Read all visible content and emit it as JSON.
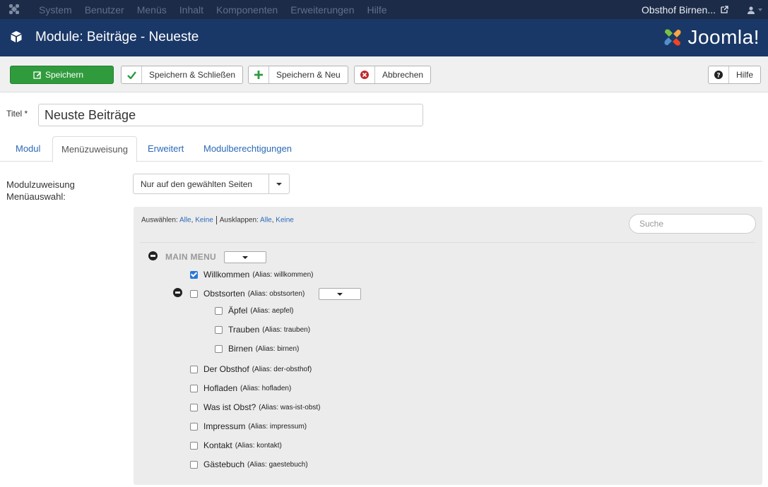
{
  "navbar": {
    "menu": [
      "System",
      "Benutzer",
      "Menüs",
      "Inhalt",
      "Komponenten",
      "Erweiterungen",
      "Hilfe"
    ],
    "site_name": "Obsthof Birnen...",
    "icons": [
      "joomla-icon",
      "external-link-icon",
      "user-icon"
    ]
  },
  "header": {
    "title": "Module: Beiträge - Neueste",
    "logo_text": "Joomla!"
  },
  "toolbar": {
    "save": "Speichern",
    "save_close": "Speichern & Schließen",
    "save_new": "Speichern & Neu",
    "cancel": "Abbrechen",
    "help": "Hilfe"
  },
  "form": {
    "title_label": "Titel *",
    "title_value": "Neuste Beiträge"
  },
  "tabs": [
    "Modul",
    "Menüzuweisung",
    "Erweitert",
    "Modulberechtigungen"
  ],
  "active_tab": "Menüzuweisung",
  "assignment": {
    "label": "Modulzuweisung",
    "value": "Nur auf den gewählten Seiten"
  },
  "menu_select": {
    "label": "Menüauswahl:",
    "select_label": "Auswählen:",
    "select_all": "Alle",
    "select_none": "Keine",
    "expand_label": "Ausklappen:",
    "expand_all": "Alle",
    "expand_none": "Keine",
    "search_placeholder": "Suche",
    "menu_title": "MAIN MENU",
    "items": [
      {
        "label": "Willkommen",
        "alias": "(Alias: willkommen)",
        "checked": true
      },
      {
        "label": "Obstsorten",
        "alias": "(Alias: obstsorten)",
        "checked": false
      },
      {
        "label": "Äpfel",
        "alias": "(Alias: aepfel)",
        "checked": false
      },
      {
        "label": "Trauben",
        "alias": "(Alias: trauben)",
        "checked": false
      },
      {
        "label": "Birnen",
        "alias": "(Alias: birnen)",
        "checked": false
      },
      {
        "label": "Der Obsthof",
        "alias": "(Alias: der-obsthof)",
        "checked": false
      },
      {
        "label": "Hofladen",
        "alias": "(Alias: hofladen)",
        "checked": false
      },
      {
        "label": "Was ist Obst?",
        "alias": "(Alias: was-ist-obst)",
        "checked": false
      },
      {
        "label": "Impressum",
        "alias": "(Alias: impressum)",
        "checked": false
      },
      {
        "label": "Kontakt",
        "alias": "(Alias: kontakt)",
        "checked": false
      },
      {
        "label": "Gästebuch",
        "alias": "(Alias: gaestebuch)",
        "checked": false
      }
    ]
  },
  "colors": {
    "navbar_bg": "#1c2c48",
    "header_bg": "#1a3867",
    "save_green": "#2f9b3d",
    "link_blue": "#2a69b8",
    "checkbox_blue": "#2a78d6"
  }
}
